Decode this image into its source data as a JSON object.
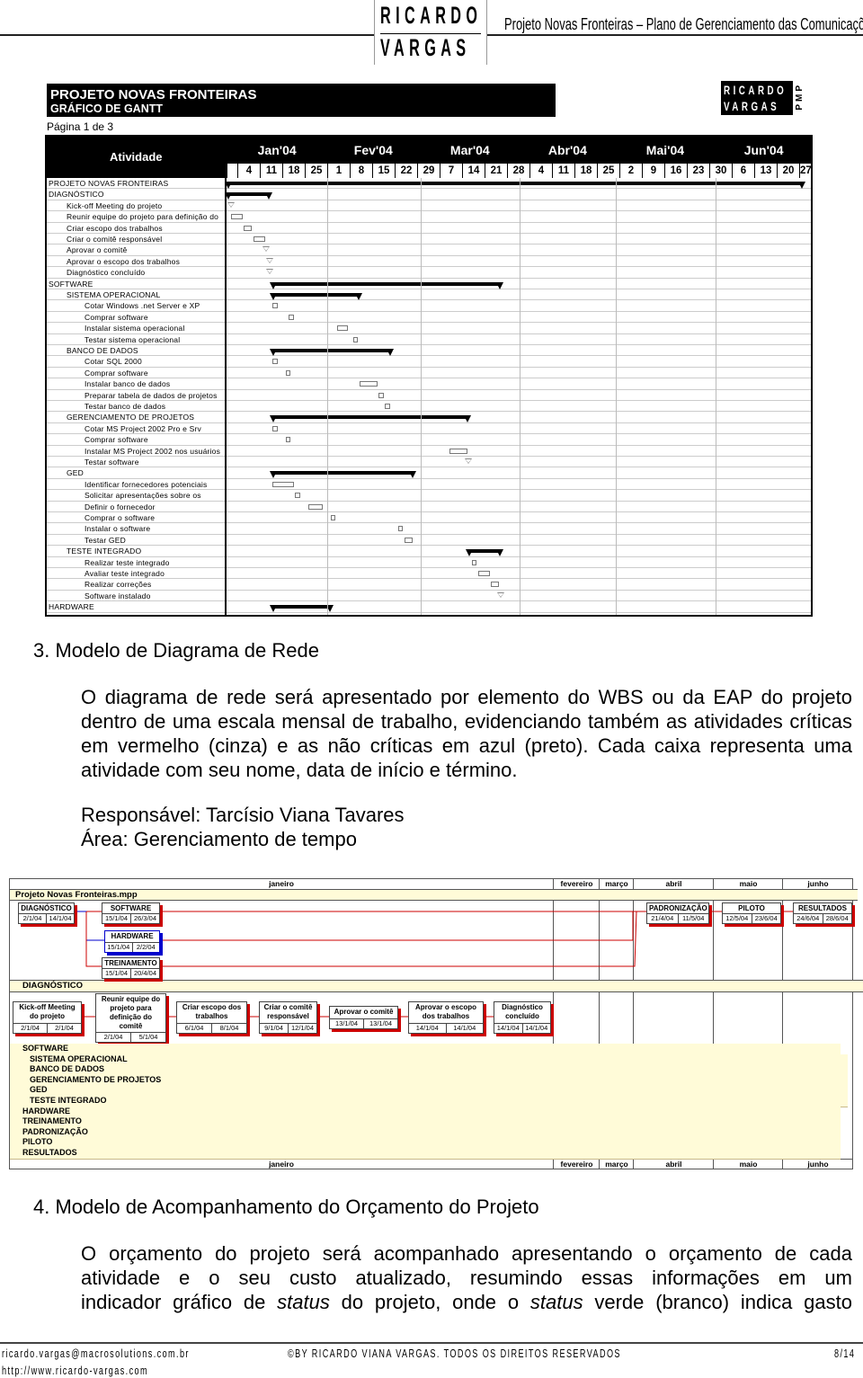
{
  "header": {
    "logo_line1": "RICARDO",
    "logo_line2": "VARGAS",
    "title": "Projeto Novas Fronteiras – Plano de Gerenciamento das Comunicações"
  },
  "gantt": {
    "title": "PROJETO NOVAS FRONTEIRAS",
    "subtitle": "GRÁFICO DE GANTT",
    "page": "Página 1 de 3",
    "logo_line1": "RICARDO",
    "logo_line2": "VARGAS",
    "logo_badge": "PMP",
    "activity_header": "Atividade",
    "months": [
      "Jan'04",
      "Fev'04",
      "Mar'04",
      "Abr'04",
      "Mai'04",
      "Jun'04"
    ],
    "weeks": [
      "4",
      "11",
      "18",
      "25",
      "1",
      "8",
      "15",
      "22",
      "29",
      "7",
      "14",
      "21",
      "28",
      "4",
      "11",
      "18",
      "25",
      "2",
      "9",
      "16",
      "23",
      "30",
      "6",
      "13",
      "20",
      "27"
    ],
    "rows": [
      {
        "label": "PROJETO NOVAS FRONTEIRAS",
        "level": 0,
        "type": "summary",
        "start": "2004-01-01",
        "end": "2004-06-28"
      },
      {
        "label": "DIAGNÓSTICO",
        "level": 0,
        "type": "summary",
        "start": "2004-01-01",
        "end": "2004-01-14"
      },
      {
        "label": "Kick-off Meeting do projeto",
        "level": 1,
        "type": "milestone",
        "start": "2004-01-02"
      },
      {
        "label": "Reunir equipe do projeto para definição do",
        "level": 1,
        "type": "task",
        "start": "2004-01-02",
        "end": "2004-01-05"
      },
      {
        "label": "Criar escopo dos trabalhos",
        "level": 1,
        "type": "task",
        "start": "2004-01-06",
        "end": "2004-01-08"
      },
      {
        "label": "Criar o comitê responsável",
        "level": 1,
        "type": "task",
        "start": "2004-01-09",
        "end": "2004-01-12"
      },
      {
        "label": "Aprovar o comitê",
        "level": 1,
        "type": "milestone",
        "start": "2004-01-13"
      },
      {
        "label": "Aprovar o escopo dos trabalhos",
        "level": 1,
        "type": "milestone",
        "start": "2004-01-14"
      },
      {
        "label": "Diagnóstico concluído",
        "level": 1,
        "type": "milestone",
        "start": "2004-01-14"
      },
      {
        "label": "SOFTWARE",
        "level": 0,
        "type": "summary",
        "start": "2004-01-15",
        "end": "2004-03-26"
      },
      {
        "label": "SISTEMA OPERACIONAL",
        "level": 1,
        "type": "summary",
        "start": "2004-01-15",
        "end": "2004-02-11"
      },
      {
        "label": "Cotar Windows .net Server e XP",
        "level": 2,
        "type": "task",
        "start": "2004-01-15",
        "end": "2004-01-16"
      },
      {
        "label": "Comprar software",
        "level": 2,
        "type": "task",
        "start": "2004-01-20",
        "end": "2004-01-21"
      },
      {
        "label": "Instalar sistema operacional",
        "level": 2,
        "type": "task",
        "start": "2004-02-04",
        "end": "2004-02-07"
      },
      {
        "label": "Testar sistema operacional",
        "level": 2,
        "type": "task",
        "start": "2004-02-09",
        "end": "2004-02-10"
      },
      {
        "label": "BANCO DE DADOS",
        "level": 1,
        "type": "summary",
        "start": "2004-01-15",
        "end": "2004-02-21"
      },
      {
        "label": "Cotar SQL 2000",
        "level": 2,
        "type": "task",
        "start": "2004-01-15",
        "end": "2004-01-16"
      },
      {
        "label": "Comprar software",
        "level": 2,
        "type": "task",
        "start": "2004-01-19",
        "end": "2004-01-20"
      },
      {
        "label": "Instalar banco de dados",
        "level": 2,
        "type": "task",
        "start": "2004-02-11",
        "end": "2004-02-16"
      },
      {
        "label": "Preparar tabela de dados de projetos",
        "level": 2,
        "type": "task",
        "start": "2004-02-17",
        "end": "2004-02-18"
      },
      {
        "label": "Testar banco de dados",
        "level": 2,
        "type": "task",
        "start": "2004-02-19",
        "end": "2004-02-20"
      },
      {
        "label": "GERENCIAMENTO DE PROJETOS",
        "level": 1,
        "type": "summary",
        "start": "2004-01-15",
        "end": "2004-03-16"
      },
      {
        "label": "Cotar MS Project 2002 Pro e Srv",
        "level": 2,
        "type": "task",
        "start": "2004-01-15",
        "end": "2004-01-16"
      },
      {
        "label": "Comprar software",
        "level": 2,
        "type": "task",
        "start": "2004-01-19",
        "end": "2004-01-20"
      },
      {
        "label": "Instalar MS Project 2002 nos usuários",
        "level": 2,
        "type": "task",
        "start": "2004-03-10",
        "end": "2004-03-15"
      },
      {
        "label": "Testar software",
        "level": 2,
        "type": "milestone",
        "start": "2004-03-16"
      },
      {
        "label": "GED",
        "level": 1,
        "type": "summary",
        "start": "2004-01-15",
        "end": "2004-02-28"
      },
      {
        "label": "Identificar fornecedores potenciais",
        "level": 2,
        "type": "task",
        "start": "2004-01-15",
        "end": "2004-01-21"
      },
      {
        "label": "Solicitar apresentações sobre os",
        "level": 2,
        "type": "task",
        "start": "2004-01-22",
        "end": "2004-01-23"
      },
      {
        "label": "Definir o fornecedor",
        "level": 2,
        "type": "task",
        "start": "2004-01-26",
        "end": "2004-01-30"
      },
      {
        "label": "Comprar o software",
        "level": 2,
        "type": "task",
        "start": "2004-02-02",
        "end": "2004-02-03"
      },
      {
        "label": "Instalar o software",
        "level": 2,
        "type": "task",
        "start": "2004-02-23",
        "end": "2004-02-24"
      },
      {
        "label": "Testar GED",
        "level": 2,
        "type": "task",
        "start": "2004-02-25",
        "end": "2004-02-27"
      },
      {
        "label": "TESTE INTEGRADO",
        "level": 1,
        "type": "summary",
        "start": "2004-03-16",
        "end": "2004-03-26"
      },
      {
        "label": "Realizar teste integrado",
        "level": 2,
        "type": "task",
        "start": "2004-03-17",
        "end": "2004-03-18"
      },
      {
        "label": "Avaliar teste integrado",
        "level": 2,
        "type": "task",
        "start": "2004-03-19",
        "end": "2004-03-22"
      },
      {
        "label": "Realizar correções",
        "level": 2,
        "type": "task",
        "start": "2004-03-23",
        "end": "2004-03-25"
      },
      {
        "label": "Software instalado",
        "level": 2,
        "type": "milestone",
        "start": "2004-03-26"
      },
      {
        "label": "HARDWARE",
        "level": 0,
        "type": "summary",
        "start": "2004-01-15",
        "end": "2004-02-02"
      }
    ]
  },
  "section3": {
    "heading": "3.  Modelo de Diagrama de Rede",
    "paragraph": "O diagrama de rede será apresentado por elemento do WBS ou da EAP do projeto dentro de uma escala mensal de trabalho, evidenciando também as atividades críticas em vermelho (cinza) e as não críticas em azul (preto). Cada caixa representa uma atividade com seu nome, data de início e término.",
    "responsible": "Responsável: Tarcísio Viana Tavares",
    "area": "Área: Gerenciamento de tempo"
  },
  "network": {
    "months": [
      "janeiro",
      "fevereiro",
      "março",
      "abril",
      "maio",
      "junho"
    ],
    "project_band": "Projeto Novas Fronteiras.mpp",
    "diag_band": "DIAGNÓSTICO",
    "boxes": [
      {
        "name": "DIAGNÓSTICO",
        "start": "2/1/04",
        "finish": "14/1/04",
        "critical": true
      },
      {
        "name": "SOFTWARE",
        "start": "15/1/04",
        "finish": "26/3/04",
        "critical": true
      },
      {
        "name": "HARDWARE",
        "start": "15/1/04",
        "finish": "2/2/04",
        "critical": false
      },
      {
        "name": "TREINAMENTO",
        "start": "15/1/04",
        "finish": "20/4/04",
        "critical": true
      },
      {
        "name": "PADRONIZAÇÃO",
        "start": "21/4/04",
        "finish": "11/5/04",
        "critical": true
      },
      {
        "name": "PILOTO",
        "start": "12/5/04",
        "finish": "23/6/04",
        "critical": true
      },
      {
        "name": "RESULTADOS",
        "start": "24/6/04",
        "finish": "28/6/04",
        "critical": true
      },
      {
        "name": "Kick-off Meeting do projeto",
        "start": "2/1/04",
        "finish": "2/1/04",
        "critical": true
      },
      {
        "name": "Reunir equipe do projeto para definição do comitê",
        "start": "2/1/04",
        "finish": "5/1/04",
        "critical": true
      },
      {
        "name": "Criar escopo dos trabalhos",
        "start": "6/1/04",
        "finish": "8/1/04",
        "critical": true
      },
      {
        "name": "Criar o comitê responsável",
        "start": "9/1/04",
        "finish": "12/1/04",
        "critical": true
      },
      {
        "name": "Aprovar o comitê",
        "start": "13/1/04",
        "finish": "13/1/04",
        "critical": true
      },
      {
        "name": "Aprovar o escopo dos trabalhos",
        "start": "14/1/04",
        "finish": "14/1/04",
        "critical": true
      },
      {
        "name": "Diagnóstico concluído",
        "start": "14/1/04",
        "finish": "14/1/04",
        "critical": true
      }
    ],
    "collapsed": [
      "SOFTWARE",
      "SISTEMA OPERACIONAL",
      "BANCO DE DADOS",
      "GERENCIAMENTO DE PROJETOS",
      "GED",
      "TESTE INTEGRADO",
      "HARDWARE",
      "TREINAMENTO",
      "PADRONIZAÇÃO",
      "PILOTO",
      "RESULTADOS"
    ],
    "critical_color": "#cc0000",
    "noncritical_color": "#0000cc"
  },
  "section4": {
    "heading": "4.  Modelo de Acompanhamento do Orçamento do Projeto",
    "paragraph_lines": [
      "O orçamento do projeto será acompanhado apresentando o orçamento de cada",
      "atividade e o seu custo atualizado, resumindo essas informações em um"
    ],
    "line3_a": "indicador gráfico de ",
    "line3_b": "status",
    "line3_c": " do projeto, onde o ",
    "line3_d": "status",
    "line3_e": " verde (branco) indica gasto"
  },
  "footer": {
    "email": "ricardo.vargas@macrosolutions.com.br",
    "url": "http://www.ricardo-vargas.com",
    "copyright": "©BY RICARDO VIANA VARGAS. TODOS OS DIREITOS RESERVADOS",
    "page": "8/14"
  }
}
